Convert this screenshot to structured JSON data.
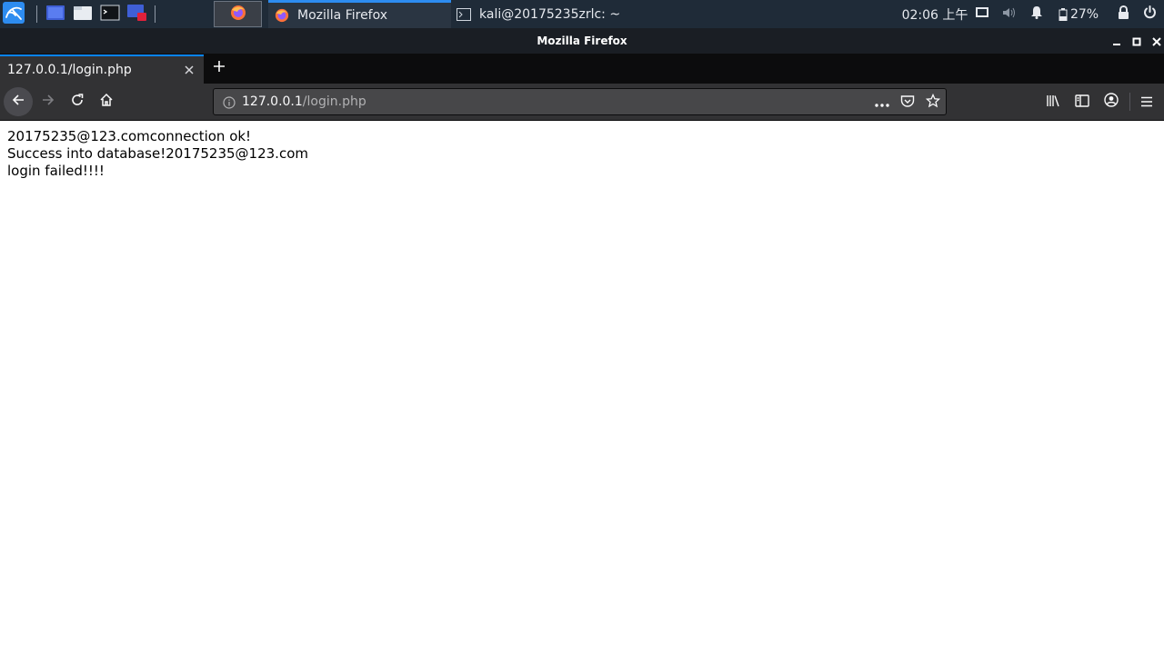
{
  "panel": {
    "tasks": [
      {
        "label": "Mozilla Firefox",
        "active": true
      },
      {
        "label": "kali@20175235zrlc: ~",
        "active": false
      }
    ],
    "clock": "02:06 上午",
    "battery": "27%",
    "icons": [
      "kali-menu-icon",
      "desktop-icon",
      "file-manager-icon",
      "terminal-icon",
      "screen-recorder-icon",
      "firefox-launcher-icon",
      "display-icon",
      "volume-icon",
      "notification-bell-icon",
      "battery-icon",
      "lock-icon",
      "power-icon"
    ],
    "accent": "#2d8cf0"
  },
  "window": {
    "title": "Mozilla Firefox"
  },
  "browser": {
    "tab_title": "127.0.0.1/login.php",
    "url_host": "127.0.0.1",
    "url_path": "/login.php",
    "accent": "#0a84ff"
  },
  "page": {
    "lines": [
      "20175235@123.comconnection ok!",
      "Success into database!20175235@123.com",
      "login failed!!!!"
    ]
  }
}
